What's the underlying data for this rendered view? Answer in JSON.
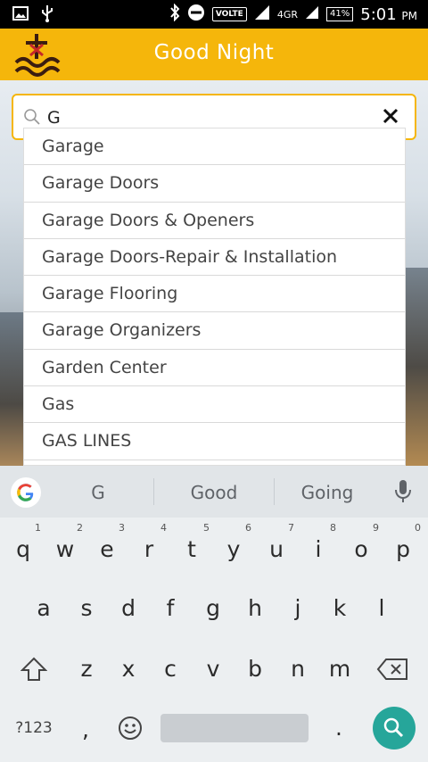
{
  "status_bar": {
    "volte": "VOLTE",
    "network": "4GR",
    "battery": "41%",
    "time": "5:01",
    "ampm": "PM"
  },
  "header": {
    "title": "Good Night"
  },
  "search": {
    "value": "G"
  },
  "suggestions": [
    "Garage",
    "Garage Doors",
    "Garage Doors & Openers",
    "Garage Doors-Repair & Installation",
    "Garage Flooring",
    "Garage Organizers",
    "Garden Center",
    "Gas",
    "GAS LINES"
  ],
  "keyboard": {
    "suggestion_words": [
      "G",
      "Good",
      "Going"
    ],
    "row1": [
      {
        "k": "q",
        "n": "1"
      },
      {
        "k": "w",
        "n": "2"
      },
      {
        "k": "e",
        "n": "3"
      },
      {
        "k": "r",
        "n": "4"
      },
      {
        "k": "t",
        "n": "5"
      },
      {
        "k": "y",
        "n": "6"
      },
      {
        "k": "u",
        "n": "7"
      },
      {
        "k": "i",
        "n": "8"
      },
      {
        "k": "o",
        "n": "9"
      },
      {
        "k": "p",
        "n": "0"
      }
    ],
    "row2": [
      "a",
      "s",
      "d",
      "f",
      "g",
      "h",
      "j",
      "k",
      "l"
    ],
    "row3": [
      "z",
      "x",
      "c",
      "v",
      "b",
      "n",
      "m"
    ],
    "symbols_key": "?123",
    "comma_key": ",",
    "period_key": ".",
    "accent_color": "#26a69a"
  },
  "colors": {
    "header_bg": "#f5b60b",
    "search_border": "#f5b60b"
  }
}
